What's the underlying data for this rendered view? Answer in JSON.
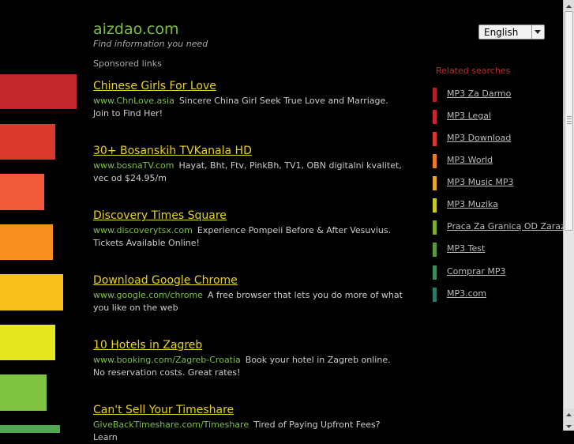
{
  "site": {
    "name": "aizdao.com",
    "tagline": "Find information you need"
  },
  "language": {
    "selected": "English"
  },
  "sponsored_label": "Sponsored links",
  "ads": [
    {
      "title": "Chinese Girls For Love",
      "url": "www.ChnLove.asia",
      "desc": "Sincere China Girl Seek True Love and Marriage. Join to Find Her!"
    },
    {
      "title": "30+ Bosanskih TVKanala HD",
      "url": "www.bosnaTV.com",
      "desc": "Hayat, Bht, Ftv, PinkBh, TV1, OBN digitalni kvalitet, vec od $24.95/m"
    },
    {
      "title": "Discovery Times Square",
      "url": "www.discoverytsx.com",
      "desc": "Experience Pompeii Before & After Vesuvius. Tickets Available Online!"
    },
    {
      "title": "Download Google Chrome",
      "url": "www.google.com/chrome",
      "desc": "A free browser that lets you do more of what you like on the web"
    },
    {
      "title": "10 Hotels in Zagreb",
      "url": "www.booking.com/Zagreb-Croatia",
      "desc": "Book your hotel in Zagreb online. No reservation costs. Great rates!"
    },
    {
      "title": "Can't Sell Your Timeshare",
      "url": "GiveBackTimeshare.com/Timeshare",
      "desc": "Tired of Paying Upfront Fees? Learn"
    }
  ],
  "related": {
    "title": "Related searches",
    "items": [
      {
        "label": "MP3 Za Darmo",
        "color": "#b81f24"
      },
      {
        "label": "MP3 Legal",
        "color": "#c8262a"
      },
      {
        "label": "MP3 Download",
        "color": "#d8392e"
      },
      {
        "label": "MP3 World",
        "color": "#e8782a"
      },
      {
        "label": "MP3 Music MP3",
        "color": "#e8a428"
      },
      {
        "label": "MP3 Muzika",
        "color": "#c9c925"
      },
      {
        "label": "Praca Za Granicą OD Zaraz",
        "color": "#7bab32"
      },
      {
        "label": "MP3 Test",
        "color": "#5a9a3a"
      },
      {
        "label": "Comprar MP3",
        "color": "#3d8a5a"
      },
      {
        "label": "MP3.com",
        "color": "#2a7a6a"
      }
    ]
  },
  "side_bars": [
    {
      "color": "#c1272d"
    },
    {
      "color": "#d93a2b"
    },
    {
      "color": "#f15a3a"
    },
    {
      "color": "#f7901e"
    },
    {
      "color": "#f9c01c"
    },
    {
      "color": "#e5e620"
    },
    {
      "color": "#80c342"
    },
    {
      "color": "#50a850"
    }
  ]
}
